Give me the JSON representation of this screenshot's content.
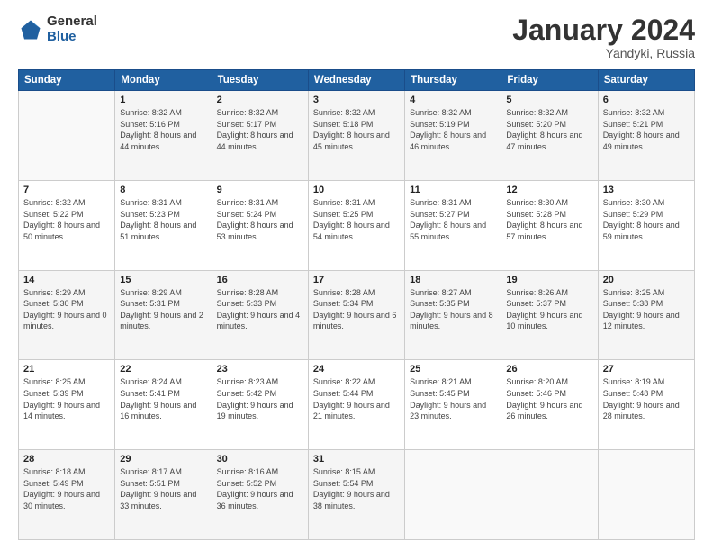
{
  "header": {
    "logo_general": "General",
    "logo_blue": "Blue",
    "month_title": "January 2024",
    "location": "Yandyki, Russia"
  },
  "weekdays": [
    "Sunday",
    "Monday",
    "Tuesday",
    "Wednesday",
    "Thursday",
    "Friday",
    "Saturday"
  ],
  "weeks": [
    [
      {
        "day": "",
        "sunrise": "",
        "sunset": "",
        "daylight": ""
      },
      {
        "day": "1",
        "sunrise": "Sunrise: 8:32 AM",
        "sunset": "Sunset: 5:16 PM",
        "daylight": "Daylight: 8 hours and 44 minutes."
      },
      {
        "day": "2",
        "sunrise": "Sunrise: 8:32 AM",
        "sunset": "Sunset: 5:17 PM",
        "daylight": "Daylight: 8 hours and 44 minutes."
      },
      {
        "day": "3",
        "sunrise": "Sunrise: 8:32 AM",
        "sunset": "Sunset: 5:18 PM",
        "daylight": "Daylight: 8 hours and 45 minutes."
      },
      {
        "day": "4",
        "sunrise": "Sunrise: 8:32 AM",
        "sunset": "Sunset: 5:19 PM",
        "daylight": "Daylight: 8 hours and 46 minutes."
      },
      {
        "day": "5",
        "sunrise": "Sunrise: 8:32 AM",
        "sunset": "Sunset: 5:20 PM",
        "daylight": "Daylight: 8 hours and 47 minutes."
      },
      {
        "day": "6",
        "sunrise": "Sunrise: 8:32 AM",
        "sunset": "Sunset: 5:21 PM",
        "daylight": "Daylight: 8 hours and 49 minutes."
      }
    ],
    [
      {
        "day": "7",
        "sunrise": "Sunrise: 8:32 AM",
        "sunset": "Sunset: 5:22 PM",
        "daylight": "Daylight: 8 hours and 50 minutes."
      },
      {
        "day": "8",
        "sunrise": "Sunrise: 8:31 AM",
        "sunset": "Sunset: 5:23 PM",
        "daylight": "Daylight: 8 hours and 51 minutes."
      },
      {
        "day": "9",
        "sunrise": "Sunrise: 8:31 AM",
        "sunset": "Sunset: 5:24 PM",
        "daylight": "Daylight: 8 hours and 53 minutes."
      },
      {
        "day": "10",
        "sunrise": "Sunrise: 8:31 AM",
        "sunset": "Sunset: 5:25 PM",
        "daylight": "Daylight: 8 hours and 54 minutes."
      },
      {
        "day": "11",
        "sunrise": "Sunrise: 8:31 AM",
        "sunset": "Sunset: 5:27 PM",
        "daylight": "Daylight: 8 hours and 55 minutes."
      },
      {
        "day": "12",
        "sunrise": "Sunrise: 8:30 AM",
        "sunset": "Sunset: 5:28 PM",
        "daylight": "Daylight: 8 hours and 57 minutes."
      },
      {
        "day": "13",
        "sunrise": "Sunrise: 8:30 AM",
        "sunset": "Sunset: 5:29 PM",
        "daylight": "Daylight: 8 hours and 59 minutes."
      }
    ],
    [
      {
        "day": "14",
        "sunrise": "Sunrise: 8:29 AM",
        "sunset": "Sunset: 5:30 PM",
        "daylight": "Daylight: 9 hours and 0 minutes."
      },
      {
        "day": "15",
        "sunrise": "Sunrise: 8:29 AM",
        "sunset": "Sunset: 5:31 PM",
        "daylight": "Daylight: 9 hours and 2 minutes."
      },
      {
        "day": "16",
        "sunrise": "Sunrise: 8:28 AM",
        "sunset": "Sunset: 5:33 PM",
        "daylight": "Daylight: 9 hours and 4 minutes."
      },
      {
        "day": "17",
        "sunrise": "Sunrise: 8:28 AM",
        "sunset": "Sunset: 5:34 PM",
        "daylight": "Daylight: 9 hours and 6 minutes."
      },
      {
        "day": "18",
        "sunrise": "Sunrise: 8:27 AM",
        "sunset": "Sunset: 5:35 PM",
        "daylight": "Daylight: 9 hours and 8 minutes."
      },
      {
        "day": "19",
        "sunrise": "Sunrise: 8:26 AM",
        "sunset": "Sunset: 5:37 PM",
        "daylight": "Daylight: 9 hours and 10 minutes."
      },
      {
        "day": "20",
        "sunrise": "Sunrise: 8:25 AM",
        "sunset": "Sunset: 5:38 PM",
        "daylight": "Daylight: 9 hours and 12 minutes."
      }
    ],
    [
      {
        "day": "21",
        "sunrise": "Sunrise: 8:25 AM",
        "sunset": "Sunset: 5:39 PM",
        "daylight": "Daylight: 9 hours and 14 minutes."
      },
      {
        "day": "22",
        "sunrise": "Sunrise: 8:24 AM",
        "sunset": "Sunset: 5:41 PM",
        "daylight": "Daylight: 9 hours and 16 minutes."
      },
      {
        "day": "23",
        "sunrise": "Sunrise: 8:23 AM",
        "sunset": "Sunset: 5:42 PM",
        "daylight": "Daylight: 9 hours and 19 minutes."
      },
      {
        "day": "24",
        "sunrise": "Sunrise: 8:22 AM",
        "sunset": "Sunset: 5:44 PM",
        "daylight": "Daylight: 9 hours and 21 minutes."
      },
      {
        "day": "25",
        "sunrise": "Sunrise: 8:21 AM",
        "sunset": "Sunset: 5:45 PM",
        "daylight": "Daylight: 9 hours and 23 minutes."
      },
      {
        "day": "26",
        "sunrise": "Sunrise: 8:20 AM",
        "sunset": "Sunset: 5:46 PM",
        "daylight": "Daylight: 9 hours and 26 minutes."
      },
      {
        "day": "27",
        "sunrise": "Sunrise: 8:19 AM",
        "sunset": "Sunset: 5:48 PM",
        "daylight": "Daylight: 9 hours and 28 minutes."
      }
    ],
    [
      {
        "day": "28",
        "sunrise": "Sunrise: 8:18 AM",
        "sunset": "Sunset: 5:49 PM",
        "daylight": "Daylight: 9 hours and 30 minutes."
      },
      {
        "day": "29",
        "sunrise": "Sunrise: 8:17 AM",
        "sunset": "Sunset: 5:51 PM",
        "daylight": "Daylight: 9 hours and 33 minutes."
      },
      {
        "day": "30",
        "sunrise": "Sunrise: 8:16 AM",
        "sunset": "Sunset: 5:52 PM",
        "daylight": "Daylight: 9 hours and 36 minutes."
      },
      {
        "day": "31",
        "sunrise": "Sunrise: 8:15 AM",
        "sunset": "Sunset: 5:54 PM",
        "daylight": "Daylight: 9 hours and 38 minutes."
      },
      {
        "day": "",
        "sunrise": "",
        "sunset": "",
        "daylight": ""
      },
      {
        "day": "",
        "sunrise": "",
        "sunset": "",
        "daylight": ""
      },
      {
        "day": "",
        "sunrise": "",
        "sunset": "",
        "daylight": ""
      }
    ]
  ]
}
